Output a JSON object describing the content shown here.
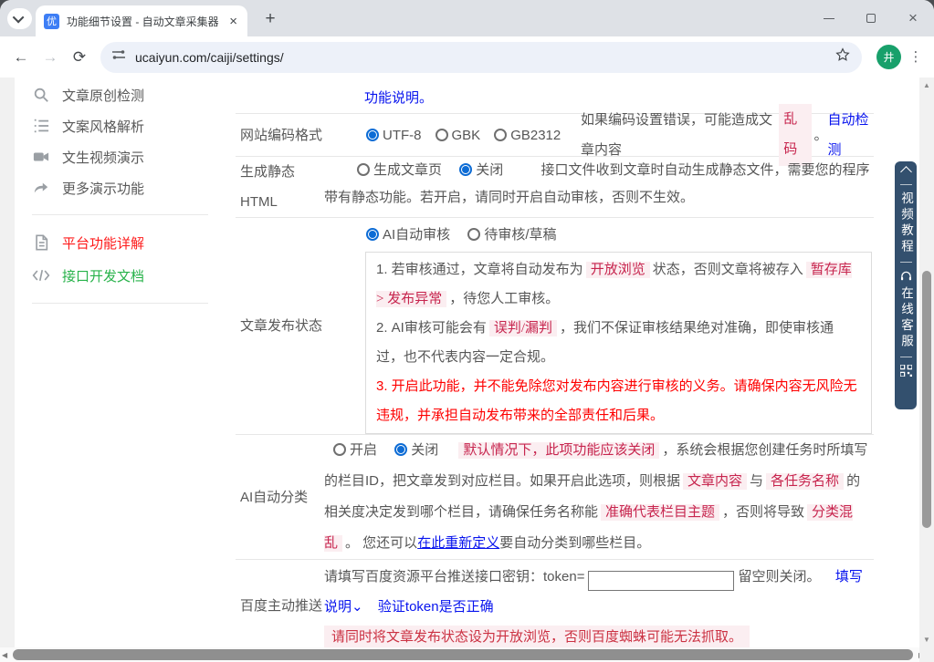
{
  "colors": {
    "link_blue": "#0713ee",
    "highlight_bg": "#fbeef1",
    "highlight_text": "#c7254e",
    "warning_red": "#fe0000",
    "panel_navy": "#33506e",
    "sidebar_red": "#fe1a1a",
    "sidebar_green": "#27b24a",
    "radio_blue": "#0d6cd5",
    "avatar_green": "#18a06b",
    "favicon_blue": "#3d7ef5"
  },
  "browser": {
    "tab_title": "功能细节设置 - 自动文章采集器",
    "favicon_char": "优",
    "url": "ucaiyun.com/caiji/settings/",
    "avatar_char": "井",
    "new_tab": "+",
    "menu_dots": "⋮",
    "back": "←",
    "forward": "→",
    "reload": "⟳"
  },
  "sidebar": {
    "items": [
      {
        "label": "文章原创检测"
      },
      {
        "label": "文案风格解析"
      },
      {
        "label": "文生视频演示"
      },
      {
        "label": "更多演示功能"
      },
      {
        "label": "平台功能详解"
      },
      {
        "label": "接口开发文档"
      }
    ]
  },
  "panel": {
    "video_label": "视频教程",
    "service_label": "在线客服"
  },
  "content": {
    "intro_link": "功能说明。",
    "encoding": {
      "label": "网站编码格式",
      "opt1": "UTF-8",
      "opt2": "GBK",
      "opt3": "GB2312",
      "text_a": "如果编码设置错误，可能造成文章内容",
      "hl": "乱码",
      "text_b": "。",
      "link": "自动检测"
    },
    "static_html": {
      "label": "生成静态HTML",
      "opt1": "生成文章页",
      "opt2": "关闭",
      "desc": "接口文件收到文章时自动生成静态文件，需要您的程序带有静态功能。若开启，请同时开启自动审核，否则不生效。"
    },
    "publish": {
      "label": "文章发布状态",
      "opt1": "AI自动审核",
      "opt2": "待审核/草稿",
      "n1a": "1. 若审核通过，文章将自动发布为",
      "n1h1": "开放浏览",
      "n1b": "状态，否则文章将被存入",
      "n1h2": "暂存库 > 发布异常",
      "n1c": "，待您人工审核。",
      "n2a": "2. AI审核可能会有",
      "n2h": "误判/漏判",
      "n2b": "，我们不保证审核结果绝对准确，即使审核通过，也不代表内容一定合规。",
      "n3": "3. 开启此功能，并不能免除您对发布内容进行审核的义务。请确保内容无风险无违规，并承担自动发布带来的全部责任和后果。"
    },
    "category": {
      "label": "AI自动分类",
      "opt1": "开启",
      "opt2": "关闭",
      "h1": "默认情况下，此项功能应该关闭",
      "t1": "，系统会根据您创建任务时所填写的栏目ID，把文章发到对应栏目。如果开启此选项，则根据",
      "h2": "文章内容",
      "t2": "与",
      "h3": "各任务名称",
      "t3": "的相关度决定发到哪个栏目，请确保任务名称能",
      "h4": "准确代表栏目主题",
      "t4": "，否则将导致",
      "h5": "分类混乱",
      "t5": "。 您还可以",
      "link": "在此重新定义",
      "t6": "要自动分类到哪些栏目。"
    },
    "baidu": {
      "label": "百度主动推送",
      "t1": "请填写百度资源平台推送接口密钥：token=",
      "t2": "留空则关闭。",
      "link1": "填写说明⌄",
      "link2": "验证token是否正确",
      "warning": "请同时将文章发布状态设为开放浏览，否则百度蜘蛛可能无法抓取。"
    }
  }
}
